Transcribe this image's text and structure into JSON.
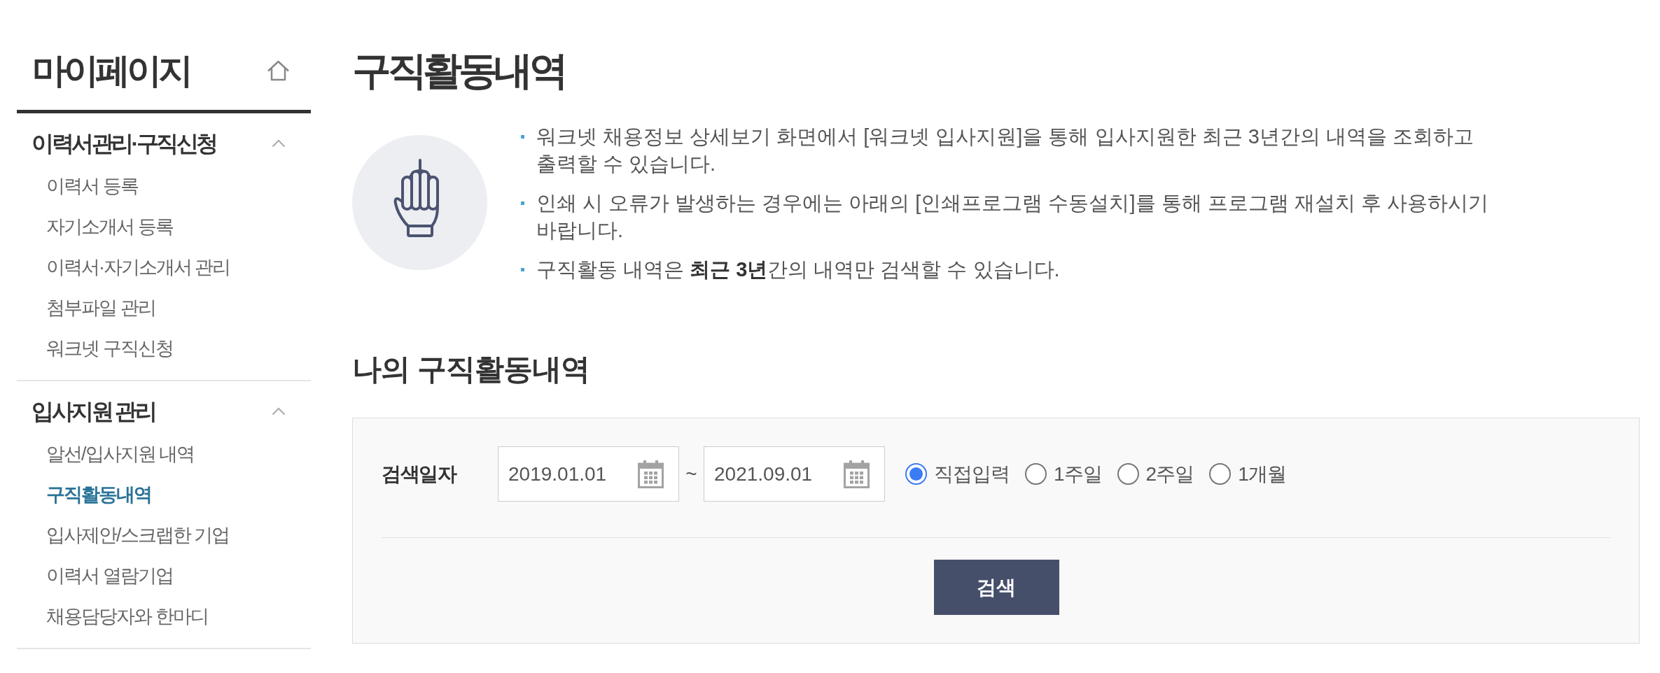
{
  "sidebar": {
    "title": "마이페이지",
    "sections": [
      {
        "title": "이력서관리·구직신청",
        "expanded": true,
        "items": [
          {
            "label": "이력서 등록",
            "selected": false
          },
          {
            "label": "자기소개서 등록",
            "selected": false
          },
          {
            "label": "이력서·자기소개서 관리",
            "selected": false
          },
          {
            "label": "첨부파일 관리",
            "selected": false
          },
          {
            "label": "워크넷 구직신청",
            "selected": false
          }
        ]
      },
      {
        "title": "입사지원 관리",
        "expanded": true,
        "items": [
          {
            "label": "알선/입사지원 내역",
            "selected": false
          },
          {
            "label": "구직활동내역",
            "selected": true
          },
          {
            "label": "입사제안/스크랩한 기업",
            "selected": false
          },
          {
            "label": "이력서 열람기업",
            "selected": false
          },
          {
            "label": "채용담당자와 한마디",
            "selected": false
          }
        ]
      }
    ]
  },
  "page": {
    "title": "구직활동내역",
    "notes": [
      "워크넷 채용정보 상세보기 화면에서 [워크넷 입사지원]을 통해 입사지원한 최근 3년간의 내역을 조회하고 출력할 수 있습니다.",
      "인쇄 시 오류가 발생하는 경우에는 아래의 [인쇄프로그램 수동설치]를 통해 프로그램 재설치 후 사용하시기 바랍니다.",
      "구직활동 내역은 **최근 3년**간의 내역만 검색할 수 있습니다."
    ]
  },
  "search": {
    "title": "나의 구직활동내역",
    "date_label": "검색일자",
    "start_date": "2019.01.01",
    "separator": "~",
    "end_date": "2021.09.01",
    "periods": [
      {
        "label": "직접입력",
        "selected": true
      },
      {
        "label": "1주일",
        "selected": false
      },
      {
        "label": "2주일",
        "selected": false
      },
      {
        "label": "1개월",
        "selected": false
      }
    ],
    "search_button": "검색"
  }
}
